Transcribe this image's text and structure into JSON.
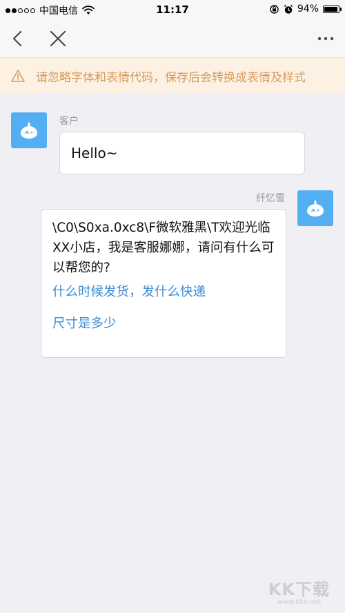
{
  "status_bar": {
    "carrier": "中国电信",
    "time": "11:17",
    "battery_percent": "94%",
    "battery_level": 0.94,
    "signal_bars_filled": 2,
    "signal_bars_total": 5
  },
  "nav": {
    "back_icon": "chevron-left-icon",
    "close_icon": "close-icon",
    "more_icon": "more-dots-icon"
  },
  "warning": {
    "icon": "warning-triangle-icon",
    "text": "请忽略字体和表情代码，保存后会转换成表情及样式",
    "text_color": "#d59a5a",
    "bg_color": "#fdf1e4"
  },
  "chat": {
    "messages": [
      {
        "sender": "客户",
        "text": "Hello~",
        "side": "left"
      },
      {
        "sender": "纤忆雪",
        "text": "\\C0\\S0xa.0xc8\\F微软雅黑\\T欢迎光临XX小店，我是客服娜娜，请问有什么可以帮您的?",
        "side": "right",
        "links": [
          "什么时候发货，发什么快递",
          "尺寸是多少"
        ]
      }
    ],
    "avatar_color": "#54aef2",
    "link_color": "#3c8dd6"
  },
  "watermark": {
    "logo": "KK下载",
    "url": "www.kkx.net"
  }
}
